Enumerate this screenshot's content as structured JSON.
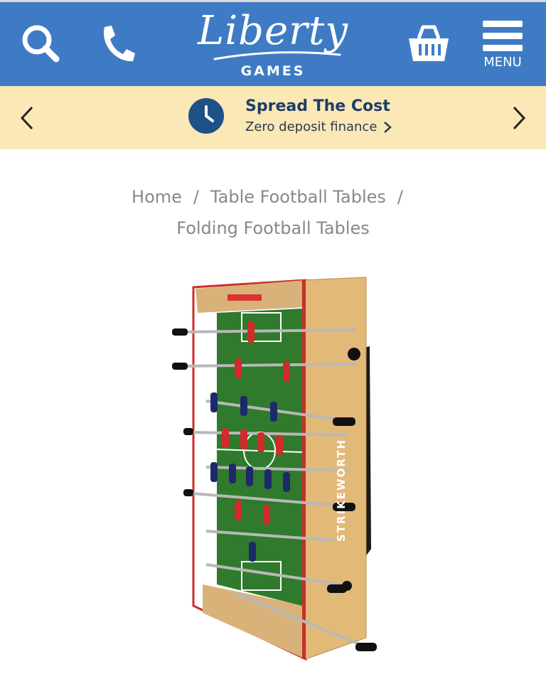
{
  "header": {
    "logo_text": "Liberty",
    "logo_subtext": "GAMES",
    "menu_label": "MENU",
    "icons": [
      "search-icon",
      "phone-icon",
      "basket-icon",
      "hamburger-icon"
    ],
    "color": "#3e7bc4"
  },
  "promo": {
    "title": "Spread The Cost",
    "subtitle": "Zero deposit finance",
    "background": "#fbe8b6",
    "icon": "clock-icon"
  },
  "breadcrumb": {
    "items": [
      "Home",
      "Table Football Tables",
      "Folding Football Tables"
    ],
    "separator": "/"
  },
  "product": {
    "image_alt": "Folding football table",
    "brand_mark": "STRIKEWORTH"
  }
}
